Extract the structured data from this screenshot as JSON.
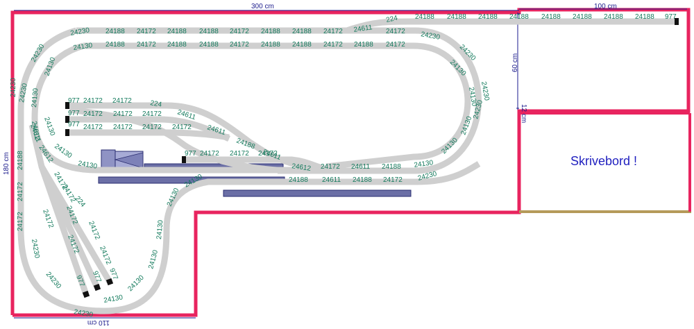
{
  "dimensions": {
    "top": "300 cm",
    "top_right": "100 cm",
    "left": "180 cm",
    "inner_vertical": "60 cm",
    "step": "12 cm",
    "bottom": "110 cm"
  },
  "desk": {
    "label": "Skrivebord !"
  },
  "colors": {
    "wall": "#e8245f",
    "desk_edge": "#b59a5a",
    "track_label": "#137a5c",
    "dimension": "#1a1a8c"
  },
  "track_labels": {
    "top_outer": [
      "24230",
      "24188",
      "24172",
      "24188",
      "24188",
      "24172",
      "24188",
      "24188",
      "24172",
      "24611",
      "24172"
    ],
    "top_inner": [
      "24130",
      "24188",
      "24172",
      "24188",
      "24188",
      "24172",
      "24188",
      "24188",
      "24172",
      "24188",
      "24172"
    ],
    "top_right_spur": [
      "224",
      "24188",
      "24188",
      "24188",
      "24188",
      "24188",
      "24188",
      "24188",
      "24188",
      "977"
    ],
    "right_curve": [
      "24230",
      "24230",
      "24230",
      "24230",
      "24130",
      "24130",
      "24130",
      "24130",
      "24230",
      "24130"
    ],
    "siding_1": [
      "977",
      "24172",
      "24172",
      "224"
    ],
    "siding_2": [
      "977",
      "24172",
      "24172",
      "24172",
      "24611"
    ],
    "siding_3": [
      "977",
      "24172",
      "24172",
      "24172",
      "24172",
      "24611"
    ],
    "siding_diag": [
      "24188",
      "24611"
    ],
    "siding_4": [
      "977",
      "24172",
      "24172",
      "24172"
    ],
    "middle_row": [
      "24612",
      "24172",
      "24611",
      "24188"
    ],
    "lower_row": [
      "24188",
      "24611",
      "24188",
      "24172"
    ],
    "left_outer": [
      "24230",
      "24230",
      "24230",
      "24188",
      "24172",
      "24172",
      "24230",
      "24230",
      "24230"
    ],
    "left_inner": [
      "24130",
      "24130",
      "24130",
      "24612",
      "24130",
      "24130"
    ],
    "yard": [
      "24611",
      "24612",
      "24172",
      "24172",
      "224",
      "24172",
      "24172",
      "24172",
      "24172",
      "24172",
      "977",
      "977",
      "977"
    ],
    "bottom_loop": [
      "24130",
      "24130",
      "24130",
      "24130",
      "24130",
      "24130"
    ]
  }
}
